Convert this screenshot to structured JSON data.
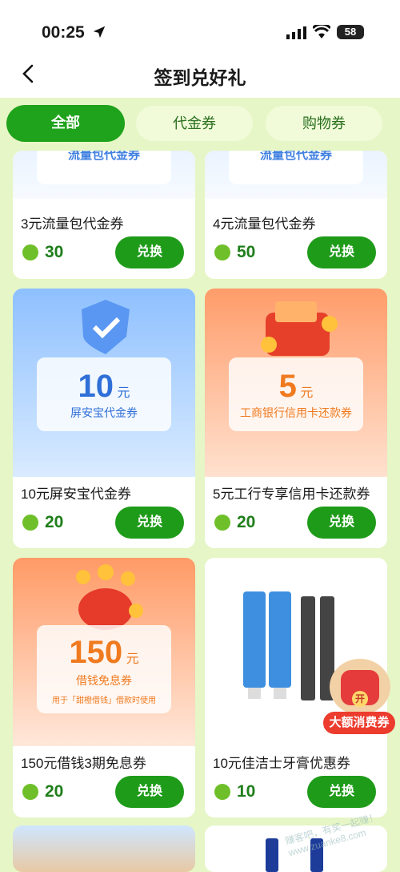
{
  "status": {
    "time": "00:25",
    "battery": "58"
  },
  "header": {
    "title": "签到兑好礼"
  },
  "tabs": [
    "全部",
    "代金券",
    "购物券"
  ],
  "cards": [
    {
      "art_label": "流量包代金券",
      "name": "3元流量包代金券",
      "points": "30",
      "btn": "兑换"
    },
    {
      "art_label": "流量包代金券",
      "name": "4元流量包代金券",
      "points": "50",
      "btn": "兑换"
    },
    {
      "amount": "10",
      "unit": "元",
      "art_label": "屏安宝代金券",
      "name": "10元屏安宝代金券",
      "points": "20",
      "btn": "兑换"
    },
    {
      "amount": "5",
      "unit": "元",
      "art_label": "工商银行信用卡还款券",
      "name": "5元工行专享信用卡还款券",
      "points": "20",
      "btn": "兑换"
    },
    {
      "amount": "150",
      "unit": "元",
      "art_label": "借钱免息券",
      "art_note": "用于「甜橙借钱」借款时使用",
      "name": "150元借钱3期免息券",
      "points": "20",
      "btn": "兑换"
    },
    {
      "name": "10元佳洁士牙膏优惠券",
      "points": "10",
      "btn": "兑换"
    }
  ],
  "float_badge": {
    "open": "开",
    "label": "大额消费券"
  },
  "watermark": "赚客吧，有奖一起赚！ www.zuanke8.com"
}
